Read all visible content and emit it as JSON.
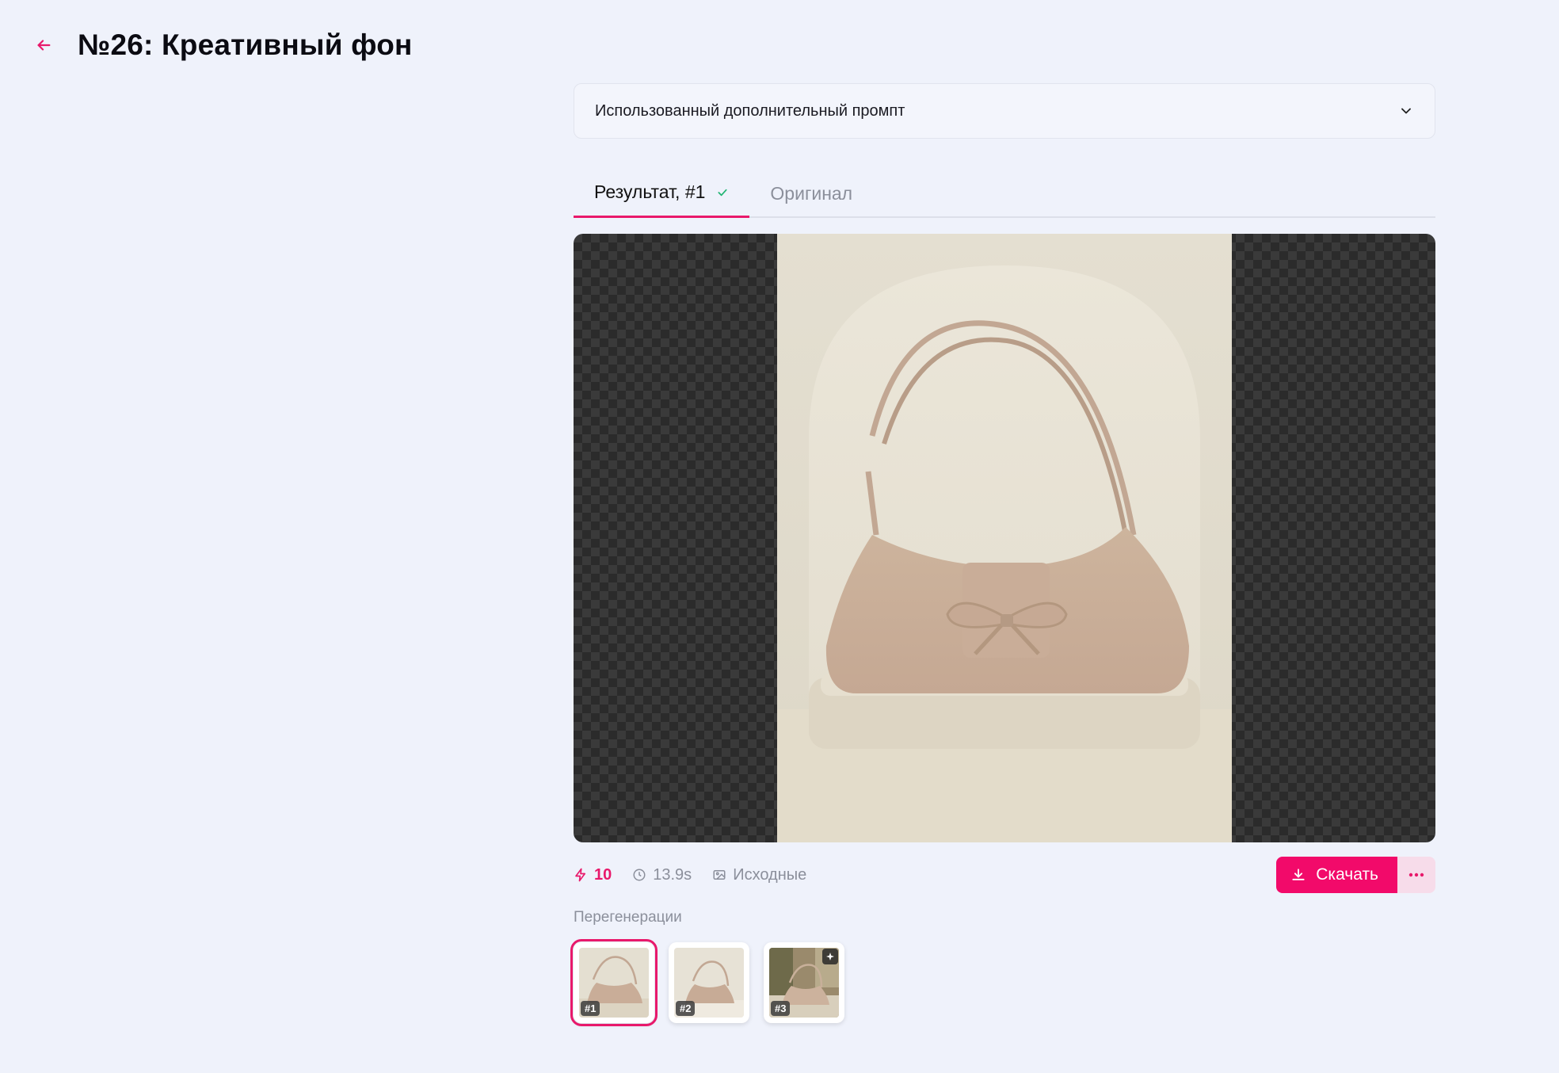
{
  "header": {
    "title": "№26: Креативный фон"
  },
  "prompt_accordion": {
    "label": "Использованный дополнительный промпт"
  },
  "tabs": [
    {
      "label": "Результат, #1",
      "active": true
    },
    {
      "label": "Оригинал",
      "active": false
    }
  ],
  "meta": {
    "credits": "10",
    "duration": "13.9s",
    "source_label": "Исходные"
  },
  "actions": {
    "download_label": "Скачать"
  },
  "regenerations": {
    "label": "Перегенерации",
    "items": [
      {
        "badge": "#1",
        "active": true
      },
      {
        "badge": "#2",
        "active": false
      },
      {
        "badge": "#3",
        "active": false
      }
    ]
  },
  "colors": {
    "accent": "#f20a6a",
    "background": "#eff2fb",
    "success": "#22b573"
  }
}
